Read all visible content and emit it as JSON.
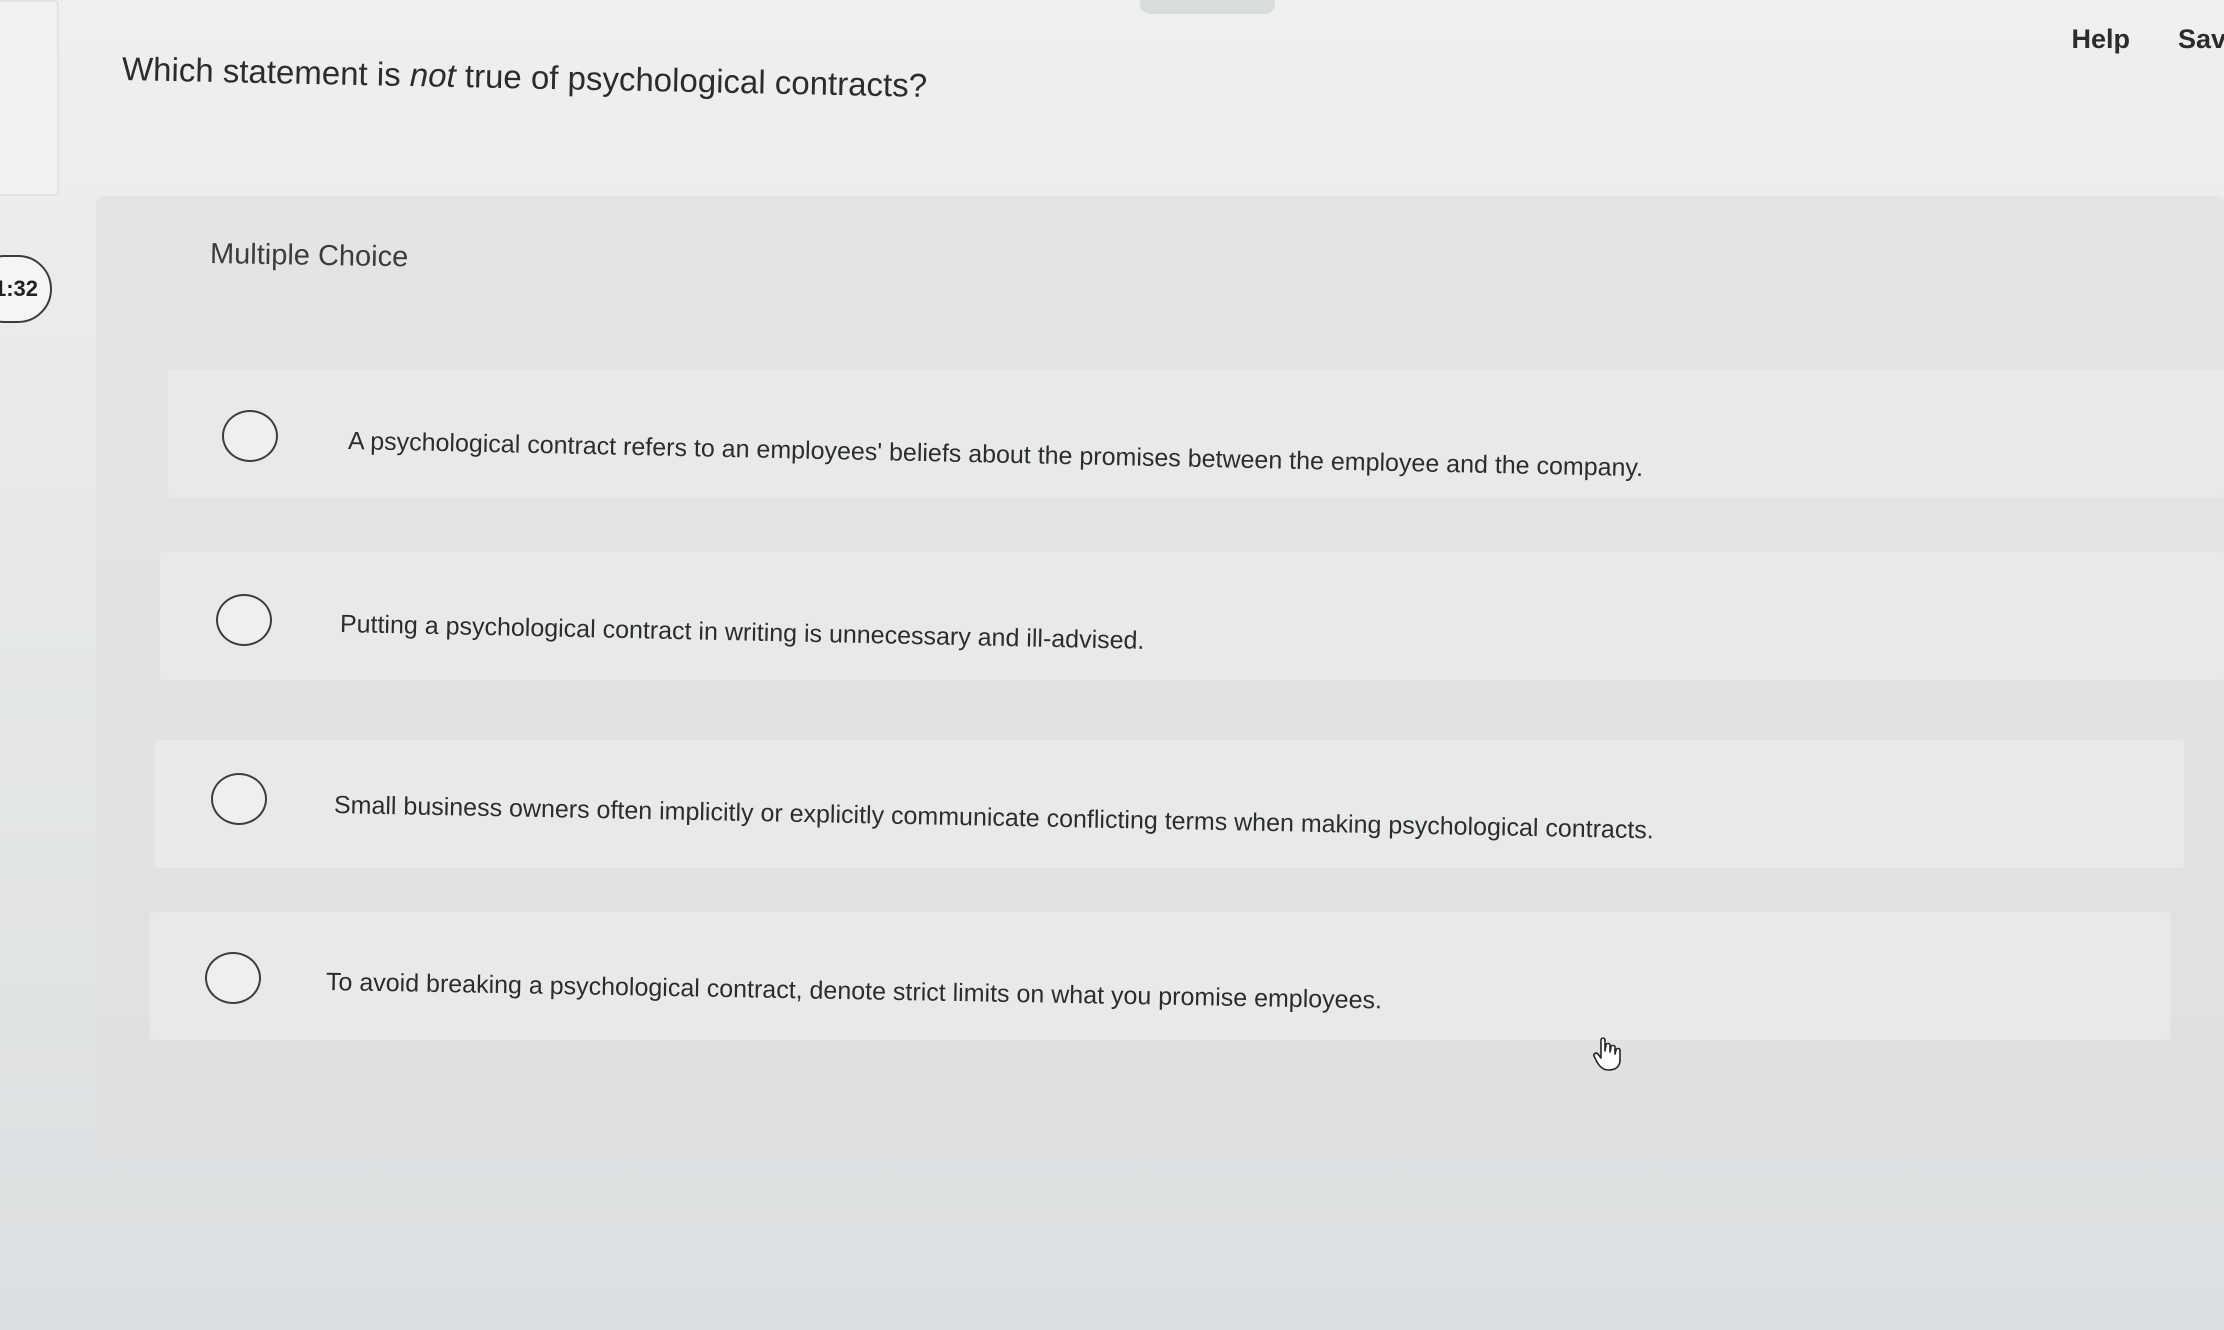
{
  "header": {
    "timer": "1:32",
    "help_label": "Help",
    "save_label": "Sav"
  },
  "question": {
    "prefix": "Which statement is ",
    "emphasis": "not",
    "suffix": " true of psychological contracts?"
  },
  "question_type": "Multiple Choice",
  "options": [
    {
      "text": "A psychological contract refers to an employees' beliefs about the promises between the employee and the company.",
      "selected": false
    },
    {
      "text": "Putting a psychological contract in writing is unnecessary and ill-advised.",
      "selected": false
    },
    {
      "text": "Small business owners often implicitly or explicitly communicate conflicting terms when making psychological contracts.",
      "selected": false
    },
    {
      "text": "To avoid breaking a psychological contract, denote strict limits on what you promise employees.",
      "selected": false
    }
  ],
  "cursor": "hand-pointer-icon"
}
